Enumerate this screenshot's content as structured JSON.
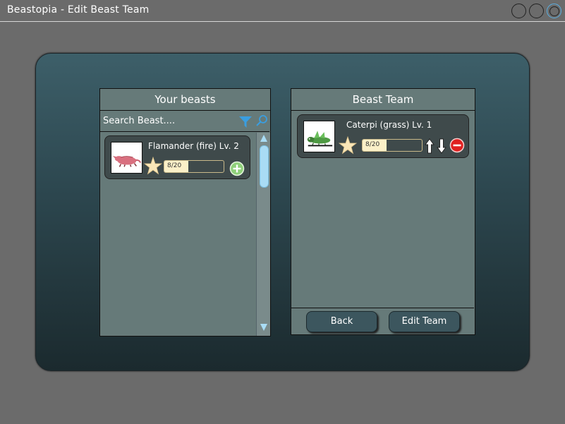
{
  "window": {
    "title": "Beastopia - Edit Beast Team"
  },
  "left_panel": {
    "header": "Your beasts",
    "search_placeholder": "Search Beast....",
    "beasts": [
      {
        "name": "Flamander (fire) Lv. 2",
        "xp_text": "8/20",
        "xp_fraction": 0.4,
        "icon": "plus-circle"
      }
    ]
  },
  "right_panel": {
    "header": "Beast Team",
    "team": [
      {
        "name": "Caterpi (grass) Lv. 1",
        "xp_text": "8/20",
        "xp_fraction": 0.4
      }
    ],
    "back_label": "Back",
    "edit_label": "Edit Team"
  },
  "colors": {
    "accent_blue": "#3a9ee0",
    "add_green": "#8fd07a",
    "remove_red": "#e02020",
    "star_fill": "#fbe7b8",
    "xp_fill": "#fbf0c8"
  }
}
